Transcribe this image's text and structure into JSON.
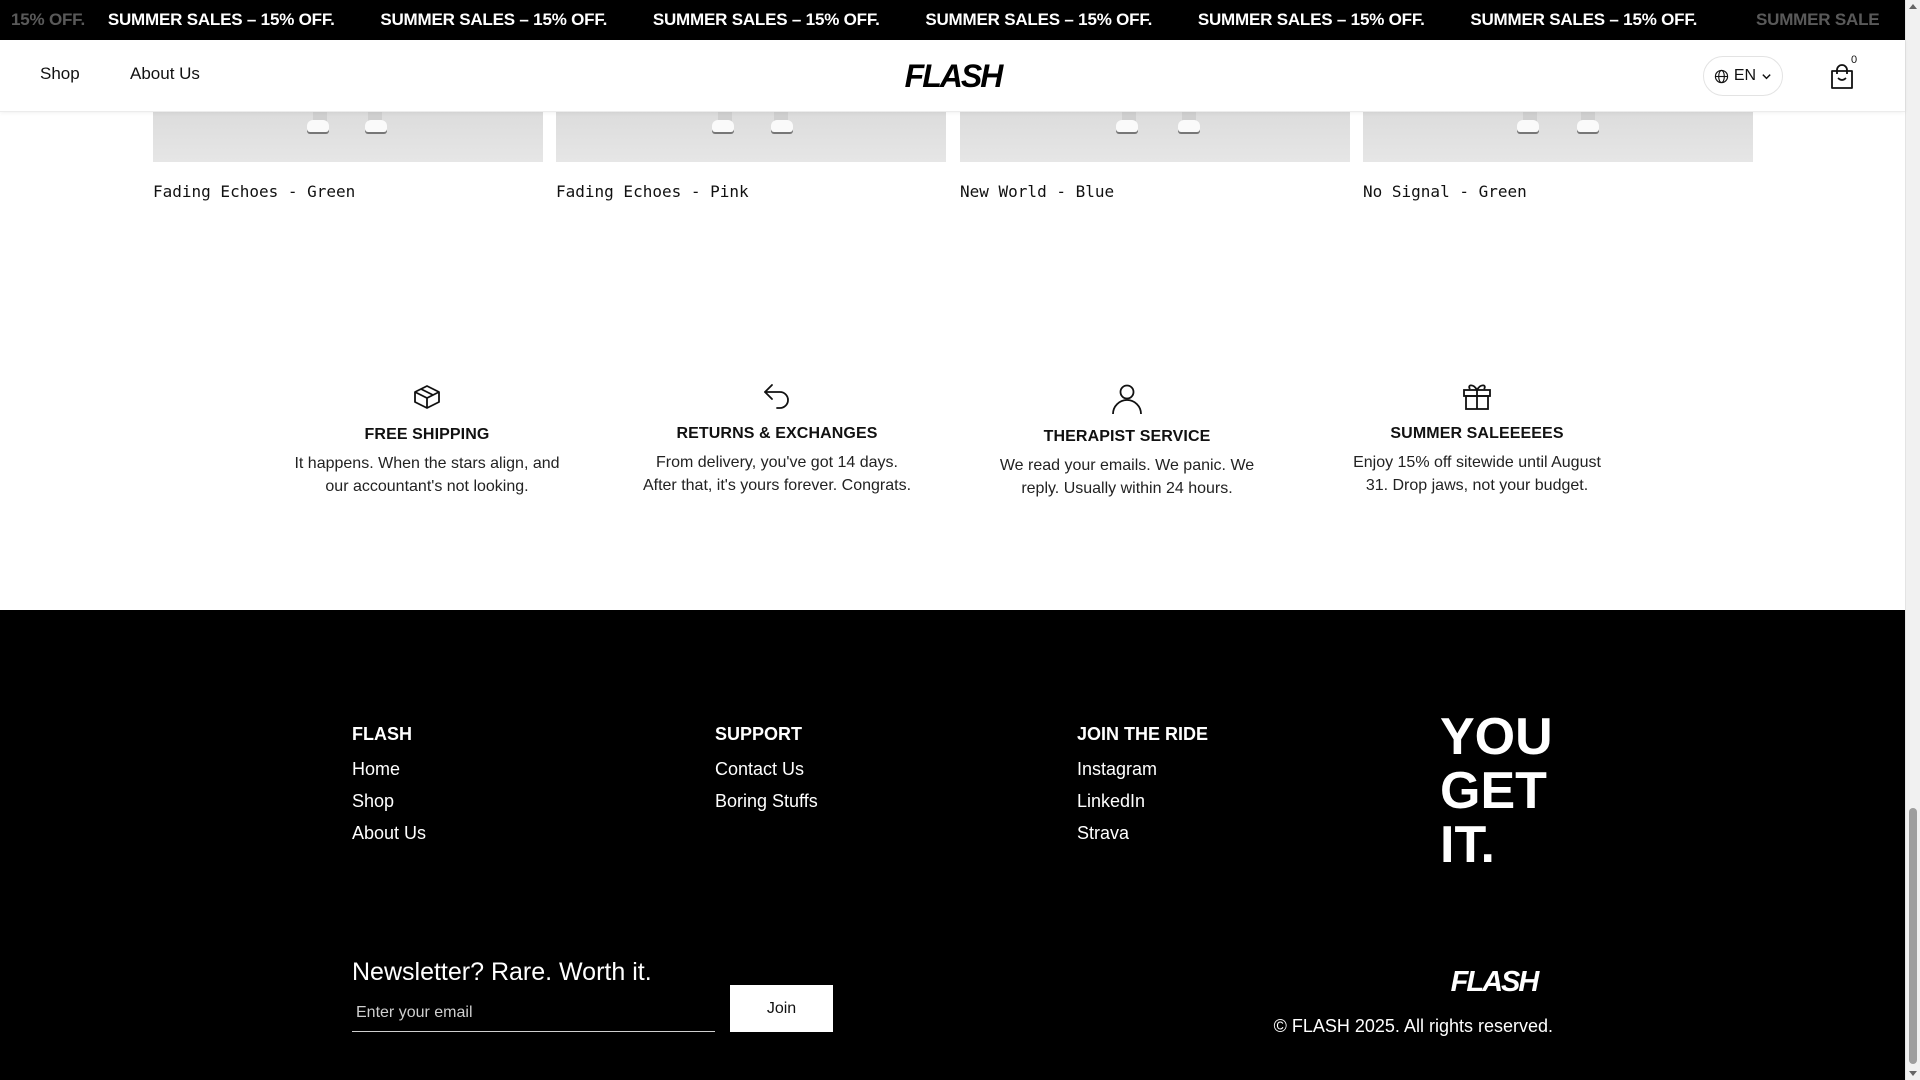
{
  "announcement": {
    "items": [
      "15% OFF.",
      "SUMMER SALES – 15% OFF.",
      "SUMMER SALES – 15% OFF.",
      "SUMMER SALES – 15% OFF.",
      "SUMMER SALES – 15% OFF.",
      "SUMMER SALES – 15% OFF.",
      "SUMMER SALES – 15% OFF.",
      "SUMMER SALE"
    ]
  },
  "header": {
    "nav": [
      "Shop",
      "About Us"
    ],
    "logo_text": "FLASH",
    "language": "EN",
    "cart_count": "0"
  },
  "products": [
    {
      "name": "Fading Echoes - Green"
    },
    {
      "name": "Fading Echoes - Pink"
    },
    {
      "name": "New World - Blue"
    },
    {
      "name": "No Signal - Green"
    }
  ],
  "features": [
    {
      "icon": "box-icon",
      "title": "FREE SHIPPING",
      "text": "It happens. When the stars align, and our accountant's not looking."
    },
    {
      "icon": "return-arrow-icon",
      "title": "RETURNS & EXCHANGES",
      "text": "From delivery, you've got 14 days. After that, it's yours forever. Congrats."
    },
    {
      "icon": "person-icon",
      "title": "THERAPIST SERVICE",
      "text": "We read your emails. We panic. We reply. Usually within 24 hours."
    },
    {
      "icon": "gift-icon",
      "title": "SUMMER SALEEEEES",
      "text": "Enjoy 15% off sitewide until August 31. Drop jaws, not your budget."
    }
  ],
  "footer": {
    "columns": [
      {
        "title": "FLASH",
        "links": [
          "Home",
          "Shop",
          "About Us"
        ]
      },
      {
        "title": "SUPPORT",
        "links": [
          "Contact Us",
          "Boring Stuffs"
        ]
      },
      {
        "title": "JOIN THE RIDE",
        "links": [
          "Instagram",
          "LinkedIn",
          "Strava"
        ]
      }
    ],
    "slogan": [
      "YOU",
      "GET",
      "IT."
    ],
    "newsletter": {
      "title": "Newsletter? Rare. Worth it.",
      "placeholder": "Enter your email",
      "button": "Join"
    },
    "logo_text": "FLASH",
    "copyright": "© FLASH 2025. All rights reserved."
  },
  "colors": {
    "background": "#ffffff",
    "footer_bg": "#000000",
    "text": "#111111",
    "accent": "#000000"
  }
}
